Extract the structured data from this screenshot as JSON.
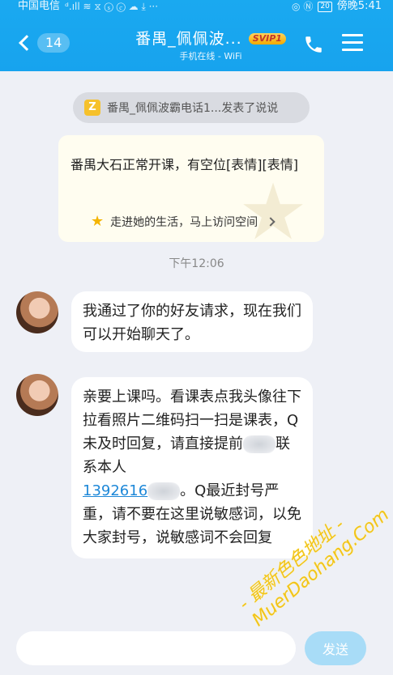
{
  "status_bar": {
    "carrier": "中国电信",
    "signal_glyphs": "ᵈ.ıll ≋ ⧖ ⓢ ⓒ ☁ ⤓ ···",
    "right_glyphs": "◎ Ⓝ",
    "battery": "20",
    "time": "傍晚5:41"
  },
  "header": {
    "unread_count": "14",
    "title": "番禺_佩佩波...",
    "vip_badge": "SVIP1",
    "subtitle": "手机在线 - WiFi"
  },
  "notice": {
    "icon_letter": "Z",
    "text": "番禺_佩佩波霸电话1...发表了说说"
  },
  "share_card": {
    "text": "番禺大石正常开课，有空位[表情][表情]",
    "footer_text": "走进她的生活，马上访问空间"
  },
  "timestamp": "下午12:06",
  "messages": [
    {
      "text": "我通过了你的好友请求，现在我们可以开始聊天了。"
    },
    {
      "text_before": "亲要上课吗。看课表点我头像往下拉看照片二维码扫一扫是课表，Q未及时回复，请直接提前",
      "text_before_2": "联系本人",
      "phone": "1392616",
      "text_after": "。Q最近封号严重，请不要在这里说敏感词，以免大家封号，说敏感词不会回复"
    }
  ],
  "input": {
    "placeholder": "",
    "send_label": "发送"
  },
  "watermark": {
    "line1": "- 最新色色地址 -",
    "line2": "MuerDaohang.Com"
  },
  "colors": {
    "header_blue": "#17a3ee",
    "background": "#eef0f6",
    "link_blue": "#1e88d8",
    "send_disabled": "#a8dcf7"
  }
}
